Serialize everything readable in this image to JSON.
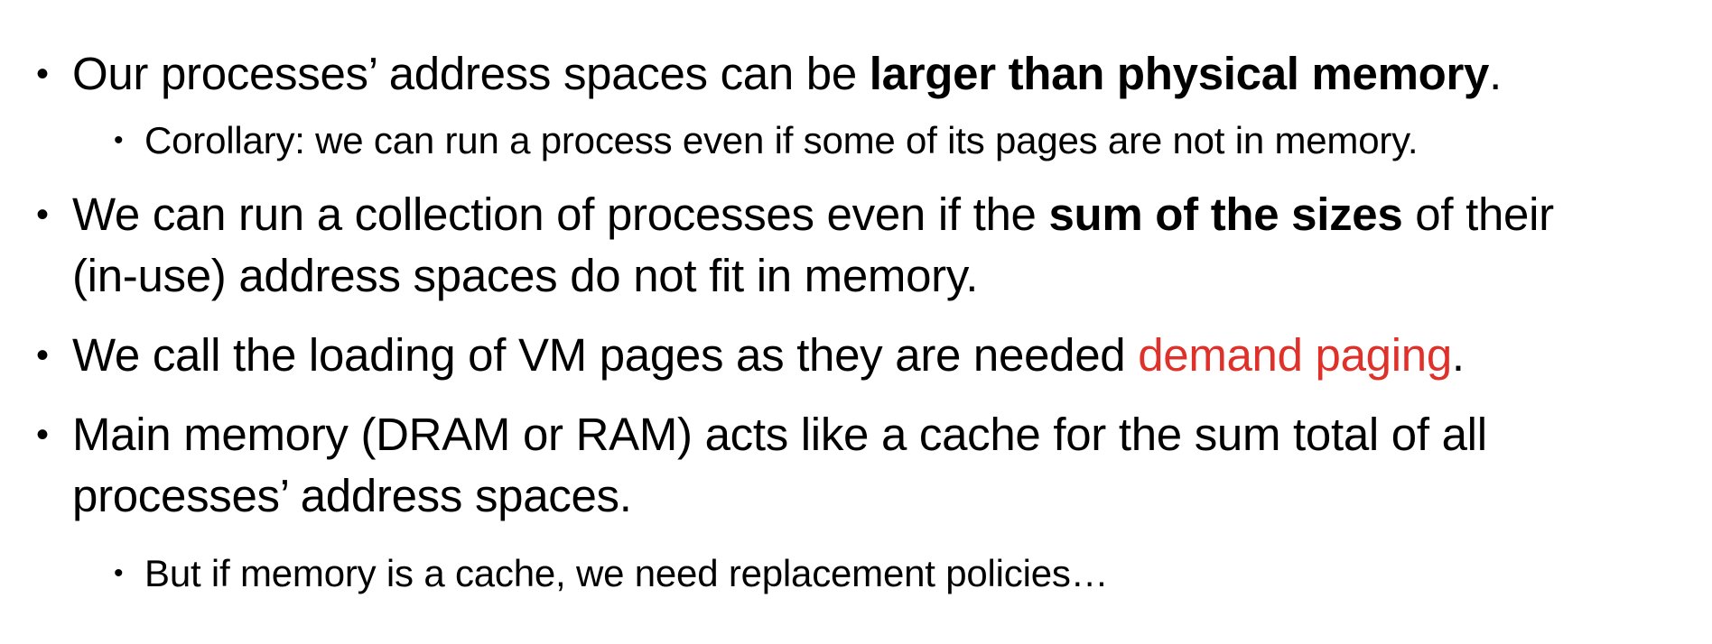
{
  "colors": {
    "text": "#000000",
    "accent": "#e0302a",
    "background": "#ffffff"
  },
  "bullets": [
    {
      "before": "Our processes’ address spaces can be ",
      "bold": "larger than physical memory",
      "after": ".",
      "sub": "Corollary: we can run a process even if some of its pages are not in memory."
    },
    {
      "before": "We can run a collection of processes even if the ",
      "bold": "sum of the sizes",
      "after": " of their (in-use) address spaces do not fit in memory."
    },
    {
      "before": "We call the loading of VM pages as they are needed ",
      "highlight": "demand paging",
      "after": "."
    },
    {
      "text": "Main memory (DRAM or RAM) acts like a cache for the sum total of all processes’ address spaces.",
      "sub": "But if memory is a cache, we need replacement policies…"
    }
  ],
  "bullet_glyph": "•"
}
